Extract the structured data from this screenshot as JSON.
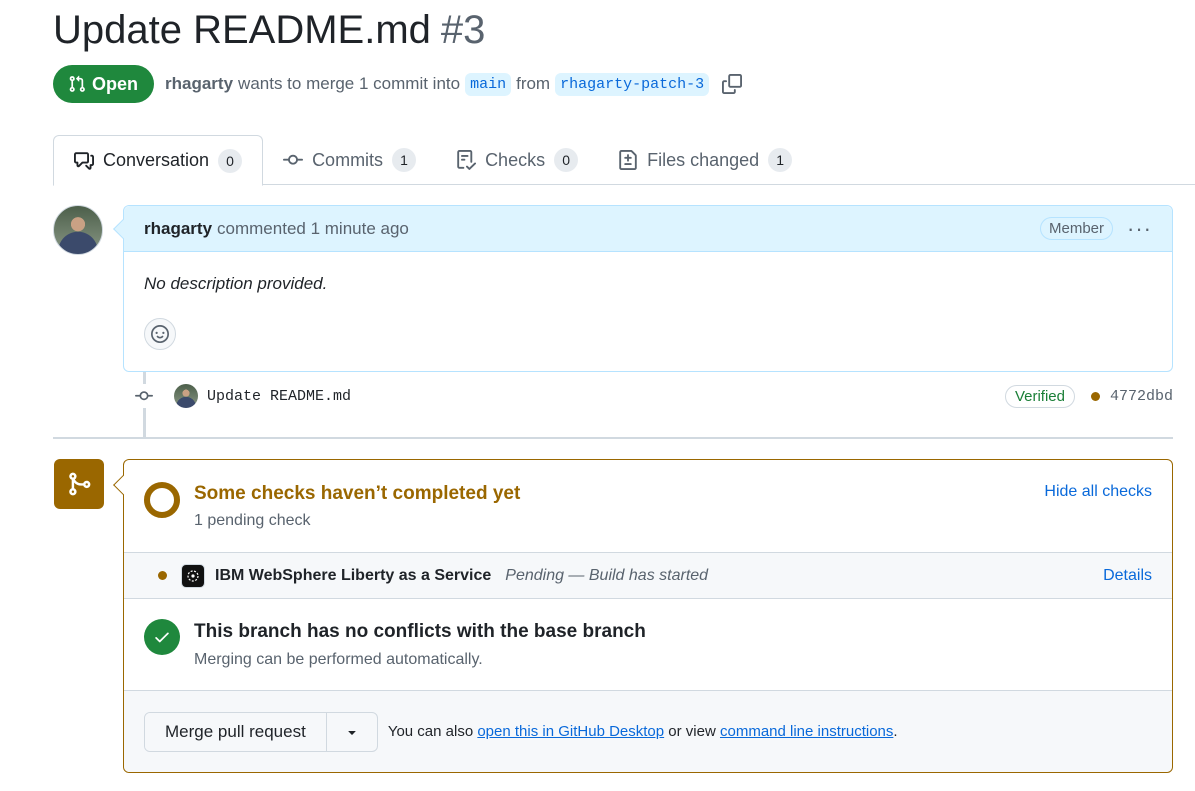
{
  "pr": {
    "title": "Update README.md",
    "number": "#3",
    "state_label": "Open",
    "author": "rhagarty",
    "merge_text": "wants to merge 1 commit into",
    "base_branch": "main",
    "from_text": "from",
    "head_branch": "rhagarty-patch-3"
  },
  "tabs": [
    {
      "label": "Conversation",
      "count": "0",
      "icon": "comment-discussion-icon"
    },
    {
      "label": "Commits",
      "count": "1",
      "icon": "git-commit-icon"
    },
    {
      "label": "Checks",
      "count": "0",
      "icon": "checklist-icon"
    },
    {
      "label": "Files changed",
      "count": "1",
      "icon": "file-diff-icon"
    }
  ],
  "comment": {
    "author": "rhagarty",
    "action": "commented 1 minute ago",
    "role_badge": "Member",
    "body": "No description provided."
  },
  "commit": {
    "message": "Update README.md",
    "badge": "Verified",
    "sha": "4772dbd"
  },
  "checks": {
    "title": "Some checks haven’t completed yet",
    "subtitle": "1 pending check",
    "toggle_label": "Hide all checks",
    "items": [
      {
        "name": "IBM WebSphere Liberty as a Service",
        "status": "Pending — Build has started",
        "link": "Details"
      }
    ]
  },
  "conflicts": {
    "title": "This branch has no conflicts with the base branch",
    "subtitle": "Merging can be performed automatically."
  },
  "merge": {
    "button_label": "Merge pull request",
    "also_text": "You can also",
    "desktop_link": "open this in GitHub Desktop",
    "or_view_text": "or view",
    "cli_link": "command line instructions",
    "period": "."
  },
  "colors": {
    "open_green": "#1f883d",
    "pending_amber": "#9a6700",
    "link_blue": "#0969da",
    "comment_header_bg": "#ddf4ff"
  }
}
